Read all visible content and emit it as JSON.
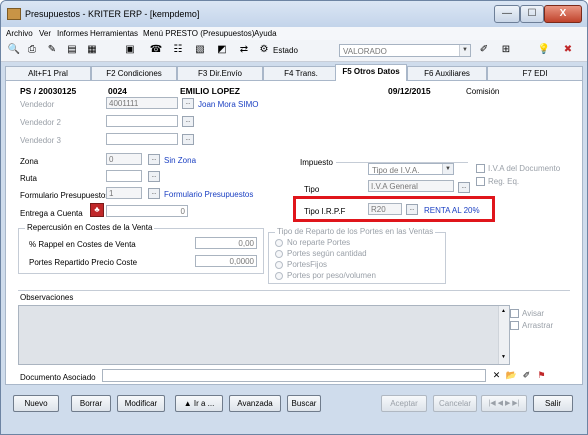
{
  "window": {
    "title": "Presupuestos - KRITER ERP - [kempdemo]",
    "minimize": "—",
    "maximize": "☐",
    "close": "X"
  },
  "menu": [
    "Archivo",
    "Ver",
    "Informes",
    "Herramientas",
    "Menú PRESTO (Presupuestos)",
    "Ayuda"
  ],
  "toolbar": {
    "estado_label": "Estado",
    "estado_value": "VALORADO"
  },
  "tabs": [
    "Alt+F1 Pral",
    "F2 Condiciones",
    "F3 Dir.Envío",
    "F4 Trans.",
    "F5 Otros Datos",
    "F6 Auxiliares",
    "F7 EDI"
  ],
  "header": {
    "doc": "PS / 20030125",
    "num": "0024",
    "client": "EMILIO LOPEZ",
    "date": "09/12/2015",
    "commission": "Comisión"
  },
  "vendedor": {
    "label": "Vendedor",
    "value": "4001111",
    "name": "Joan Mora SIMO"
  },
  "vendedor2": {
    "label": "Vendedor 2"
  },
  "vendedor3": {
    "label": "Vendedor 3"
  },
  "zona": {
    "label": "Zona",
    "value": "0",
    "name": "Sin Zona"
  },
  "ruta": {
    "label": "Ruta"
  },
  "formulario": {
    "label": "Formulario Presupuestos",
    "value": "1",
    "name": "Formulario Presupuestos"
  },
  "entrega": {
    "label": "Entrega a Cuenta",
    "value": "0"
  },
  "impuesto": {
    "group": "Impuesto",
    "tipo_iva_value": "Tipo de I.V.A.",
    "tipo_label": "Tipo",
    "tipo_value": "I.V.A General",
    "iva_doc": "I.V.A del Documento",
    "reg_eq": "Reg. Eq."
  },
  "irpf": {
    "label": "Tipo I.R.P.F",
    "code": "R20",
    "name": "RENTA AL 20%"
  },
  "costes": {
    "group": "Repercusión en Costes de la Venta",
    "rappel_label": "% Rappel en Costes de Venta",
    "rappel_value": "0,00",
    "portes_label": "Portes Repartido Precio Coste",
    "portes_value": "0,0000"
  },
  "reparto": {
    "group": "Tipo de Reparto de los Portes en las Ventas",
    "options": [
      "No reparte Portes",
      "Portes según cantidad",
      "PortesFijos",
      "Portes por peso/volumen"
    ]
  },
  "observaciones": {
    "label": "Observaciones",
    "avisar": "Avisar",
    "arrastrar": "Arrastrar"
  },
  "documento": {
    "label": "Documento Asociado"
  },
  "buttons": {
    "nuevo": "Nuevo",
    "borrar": "Borrar",
    "modificar": "Modificar",
    "ira": "▲ Ir a ...",
    "avanzada": "Avanzada",
    "buscar": "Buscar",
    "aceptar": "Aceptar",
    "cancelar": "Cancelar",
    "salir": "Salir"
  }
}
